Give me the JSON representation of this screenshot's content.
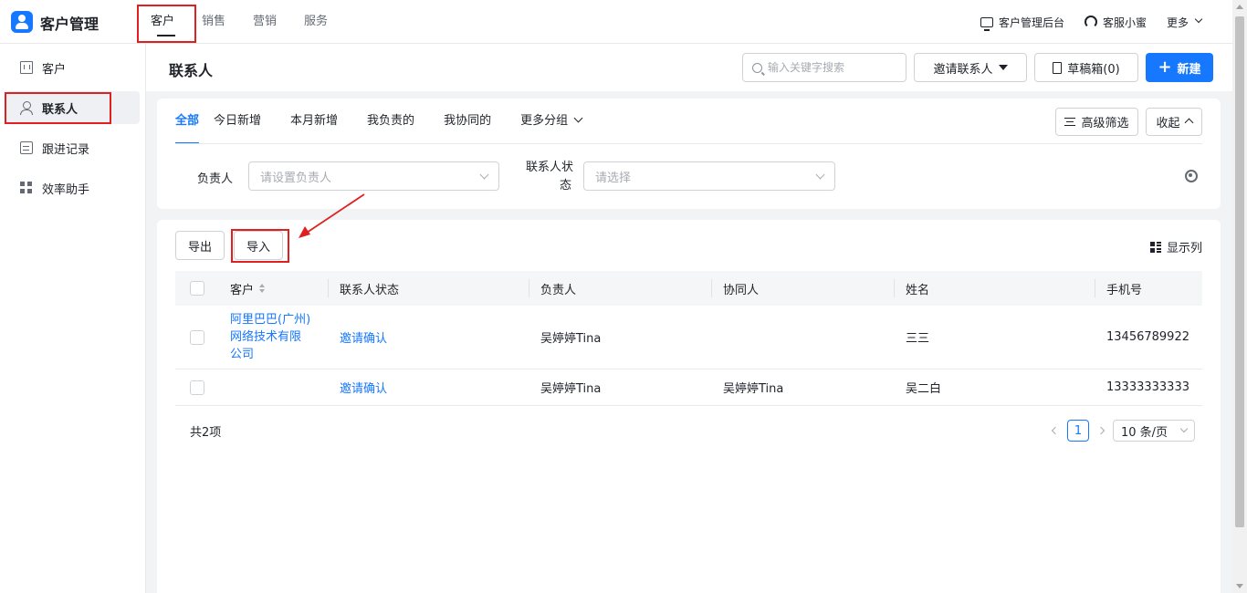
{
  "app": {
    "title": "客户管理"
  },
  "top_nav": [
    {
      "label": "客户",
      "active": true
    },
    {
      "label": "销售",
      "active": false
    },
    {
      "label": "营销",
      "active": false
    },
    {
      "label": "服务",
      "active": false
    }
  ],
  "top_right": {
    "admin": "客户管理后台",
    "service": "客服小蜜",
    "more": "更多"
  },
  "sidebar": {
    "items": [
      {
        "label": "客户",
        "icon": "building-icon",
        "active": false
      },
      {
        "label": "联系人",
        "icon": "person-icon",
        "active": true
      },
      {
        "label": "跟进记录",
        "icon": "document-icon",
        "active": false
      },
      {
        "label": "效率助手",
        "icon": "grid-icon",
        "active": false
      }
    ]
  },
  "header": {
    "title": "联系人",
    "search_placeholder": "输入关键字搜索",
    "invite_label": "邀请联系人",
    "draft_label": "草稿箱(0)",
    "new_label": "新建"
  },
  "filters": {
    "tabs": [
      "全部",
      "今日新增",
      "本月新增",
      "我负责的",
      "我协同的",
      "更多分组"
    ],
    "active_tab": "全部",
    "advanced_label": "高级筛选",
    "collapse_label": "收起",
    "owner_label": "负责人",
    "owner_placeholder": "请设置负责人",
    "status_label_line1": "联系人状",
    "status_label_line2": "态",
    "status_placeholder": "请选择"
  },
  "toolbar": {
    "export_label": "导出",
    "import_label": "导入",
    "columns_label": "显示列"
  },
  "table": {
    "columns": [
      "客户",
      "联系人状态",
      "负责人",
      "协同人",
      "姓名",
      "手机号"
    ],
    "rows": [
      {
        "customer_lines": [
          "阿里巴巴(广州)",
          "网络技术有限",
          "公司"
        ],
        "status": "邀请确认",
        "owner": "吴婷婷Tina",
        "collaborator": "",
        "name": "三三",
        "phone": "13456789922"
      },
      {
        "customer_lines": [],
        "status": "邀请确认",
        "owner": "吴婷婷Tina",
        "collaborator": "吴婷婷Tina",
        "name": "吴二白",
        "phone": "13333333333"
      }
    ]
  },
  "pagination": {
    "total": "共2项",
    "current_page": "1",
    "page_size": "10 条/页"
  },
  "colors": {
    "accent": "#1677ff",
    "highlight": "#e02020"
  }
}
